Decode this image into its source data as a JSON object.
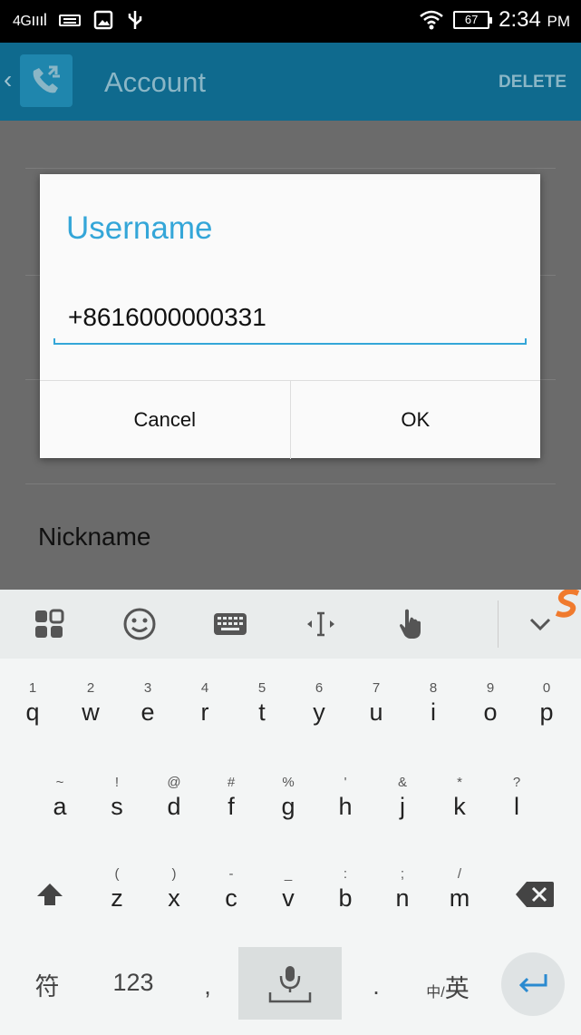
{
  "status_bar": {
    "network": "4G",
    "battery": "67",
    "time": "2:34",
    "ampm": "PM"
  },
  "app_bar": {
    "title": "Account",
    "delete_label": "DELETE"
  },
  "background": {
    "nickname_label": "Nickname"
  },
  "dialog": {
    "title": "Username",
    "value": "+8616000000331",
    "cancel_label": "Cancel",
    "ok_label": "OK",
    "accent_color": "#34a6d8"
  },
  "keyboard": {
    "row1": [
      {
        "hint": "1",
        "char": "q"
      },
      {
        "hint": "2",
        "char": "w"
      },
      {
        "hint": "3",
        "char": "e"
      },
      {
        "hint": "4",
        "char": "r"
      },
      {
        "hint": "5",
        "char": "t"
      },
      {
        "hint": "6",
        "char": "y"
      },
      {
        "hint": "7",
        "char": "u"
      },
      {
        "hint": "8",
        "char": "i"
      },
      {
        "hint": "9",
        "char": "o"
      },
      {
        "hint": "0",
        "char": "p"
      }
    ],
    "row2": [
      {
        "hint": "~",
        "char": "a"
      },
      {
        "hint": "!",
        "char": "s"
      },
      {
        "hint": "@",
        "char": "d"
      },
      {
        "hint": "#",
        "char": "f"
      },
      {
        "hint": "%",
        "char": "g"
      },
      {
        "hint": "'",
        "char": "h"
      },
      {
        "hint": "&",
        "char": "j"
      },
      {
        "hint": "*",
        "char": "k"
      },
      {
        "hint": "?",
        "char": "l"
      }
    ],
    "row3": [
      {
        "hint": "(",
        "char": "z"
      },
      {
        "hint": ")",
        "char": "x"
      },
      {
        "hint": "-",
        "char": "c"
      },
      {
        "hint": "_",
        "char": "v"
      },
      {
        "hint": ":",
        "char": "b"
      },
      {
        "hint": ";",
        "char": "n"
      },
      {
        "hint": "/",
        "char": "m"
      }
    ],
    "symbol_key": "符",
    "numbers_key": "123",
    "comma_key": ",",
    "period_key": ".",
    "lang_key_small": "中/",
    "lang_key": "英"
  }
}
